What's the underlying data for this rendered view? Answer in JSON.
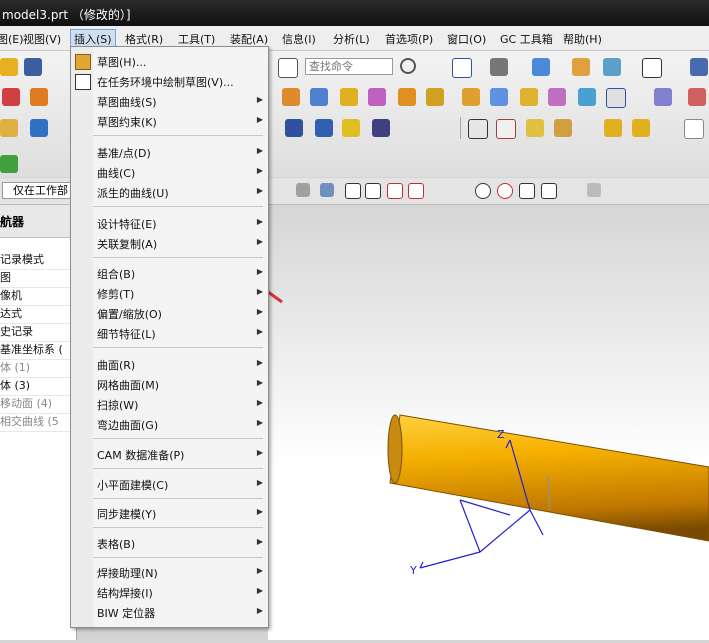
{
  "window": {
    "title": "model3.prt （修改的）]"
  },
  "menubar": {
    "items": [
      {
        "label": "图(E)"
      },
      {
        "label": "视图(V)"
      },
      {
        "label": "插入(S)"
      },
      {
        "label": "格式(R)"
      },
      {
        "label": "工具(T)"
      },
      {
        "label": "装配(A)"
      },
      {
        "label": "信息(I)"
      },
      {
        "label": "分析(L)"
      },
      {
        "label": "首选项(P)"
      },
      {
        "label": "窗口(O)"
      },
      {
        "label": "GC 工具箱"
      },
      {
        "label": "帮助(H)"
      }
    ]
  },
  "toolbar": {
    "search_placeholder": "查找命令"
  },
  "selection_bar": {
    "filter_value": "仅在工作部"
  },
  "navigator": {
    "header": "航器",
    "rows": [
      {
        "label": "记录模式",
        "dim": false
      },
      {
        "label": "图",
        "dim": false
      },
      {
        "label": "像机",
        "dim": false
      },
      {
        "label": "达式",
        "dim": false
      },
      {
        "label": "史记录",
        "dim": false
      },
      {
        "label": "基准坐标系 (",
        "dim": false
      },
      {
        "label": "体 (1)",
        "dim": true
      },
      {
        "label": "体 (3)",
        "dim": false
      },
      {
        "label": "移动面 (4)",
        "dim": true
      },
      {
        "label": "相交曲线 (5",
        "dim": true
      }
    ]
  },
  "insert_menu": {
    "items": [
      {
        "label": "草图(H)...",
        "submenu": false,
        "icon": "sketch-icon"
      },
      {
        "label": "在任务环境中绘制草图(V)...",
        "submenu": false,
        "icon": "task-sketch-icon"
      },
      {
        "label": "草图曲线(S)",
        "submenu": true
      },
      {
        "label": "草图约束(K)",
        "submenu": true
      },
      {
        "sep": true
      },
      {
        "label": "基准/点(D)",
        "submenu": true
      },
      {
        "label": "曲线(C)",
        "submenu": true
      },
      {
        "label": "派生的曲线(U)",
        "submenu": true
      },
      {
        "sep": true
      },
      {
        "label": "设计特征(E)",
        "submenu": true
      },
      {
        "label": "关联复制(A)",
        "submenu": true
      },
      {
        "sep": true
      },
      {
        "label": "组合(B)",
        "submenu": true
      },
      {
        "label": "修剪(T)",
        "submenu": true
      },
      {
        "label": "偏置/缩放(O)",
        "submenu": true
      },
      {
        "label": "细节特征(L)",
        "submenu": true
      },
      {
        "sep": true
      },
      {
        "label": "曲面(R)",
        "submenu": true
      },
      {
        "label": "网格曲面(M)",
        "submenu": true
      },
      {
        "label": "扫掠(W)",
        "submenu": true
      },
      {
        "label": "弯边曲面(G)",
        "submenu": true
      },
      {
        "sep": true
      },
      {
        "label": "CAM 数据准备(P)",
        "submenu": true
      },
      {
        "sep": true
      },
      {
        "label": "小平面建模(C)",
        "submenu": true
      },
      {
        "sep": true
      },
      {
        "label": "同步建模(Y)",
        "submenu": true
      },
      {
        "sep": true
      },
      {
        "label": "表格(B)",
        "submenu": true
      },
      {
        "sep": true
      },
      {
        "label": "焊接助理(N)",
        "submenu": true
      },
      {
        "label": "结构焊接(I)",
        "submenu": true
      },
      {
        "label": "BIW 定位器",
        "submenu": true
      }
    ]
  },
  "viewport": {
    "axis_labels": {
      "z": "Z",
      "y": "Y"
    },
    "cylinder_color": "#f0a800"
  },
  "colors": {
    "menu_active": "#cfdff3",
    "annotation_arrow": "#e03030",
    "csys_blue": "#2020d0"
  }
}
